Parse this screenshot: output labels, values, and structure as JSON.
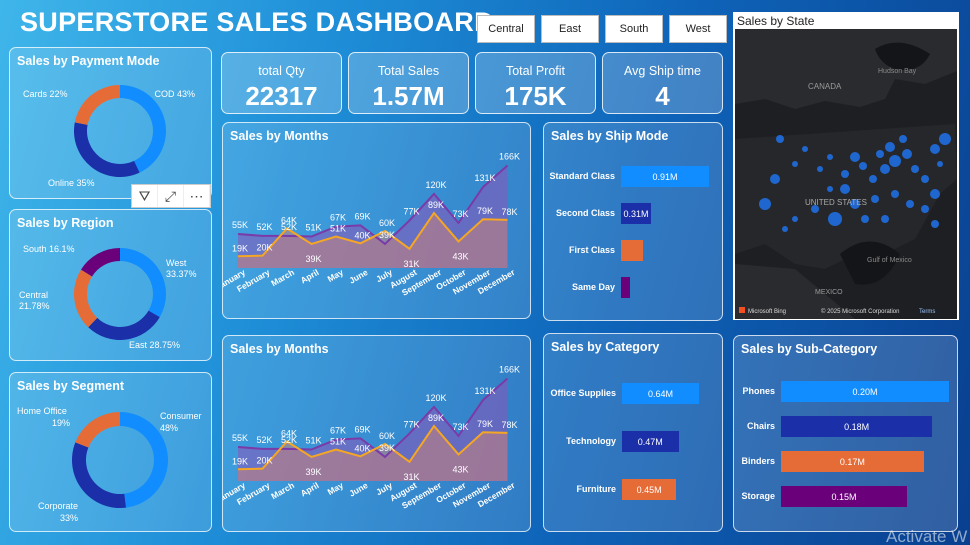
{
  "header": {
    "title": "SUPERSTORE SALES DASHBOARD"
  },
  "slicers": [
    "Central",
    "East",
    "South",
    "West"
  ],
  "kpis": [
    {
      "label": "total Qty",
      "value": "22317"
    },
    {
      "label": "Total Sales",
      "value": "1.57M"
    },
    {
      "label": "Total Profit",
      "value": "175K"
    },
    {
      "label": "Avg Ship time",
      "value": "4"
    }
  ],
  "payment": {
    "title": "Sales by Payment Mode",
    "slices": [
      {
        "label": "COD 43%",
        "value": 43,
        "color": "#118dff"
      },
      {
        "label": "Online 35%",
        "value": 35,
        "color": "#1a2fa8"
      },
      {
        "label": "Cards 22%",
        "value": 22,
        "color": "#e66c37"
      }
    ]
  },
  "region": {
    "title": "Sales by Region",
    "slices": [
      {
        "label": "West",
        "pct": "33.37%",
        "value": 33.37,
        "color": "#118dff"
      },
      {
        "label": "East 28.75%",
        "value": 28.75,
        "color": "#1a2fa8"
      },
      {
        "label": "Central",
        "pct": "21.78%",
        "value": 21.78,
        "color": "#e66c37"
      },
      {
        "label": "South 16.1%",
        "value": 16.1,
        "color": "#6b007b"
      }
    ]
  },
  "segment": {
    "title": "Sales by Segment",
    "slices": [
      {
        "label": "Consumer",
        "pct": "48%",
        "value": 48,
        "color": "#118dff"
      },
      {
        "label": "Corporate",
        "pct": "33%",
        "value": 33,
        "color": "#1a2fa8"
      },
      {
        "label": "Home Office",
        "pct": "19%",
        "value": 19,
        "color": "#e66c37"
      }
    ]
  },
  "months_chart": {
    "title": "Sales by Months"
  },
  "chart_data": [
    {
      "type": "area",
      "title": "Sales by Months",
      "categories": [
        "January",
        "February",
        "March",
        "April",
        "May",
        "June",
        "July",
        "August",
        "September",
        "October",
        "November",
        "December"
      ],
      "series": [
        {
          "values": [
            55,
            52,
            52,
            51,
            67,
            69,
            39,
            77,
            120,
            73,
            131,
            166
          ],
          "labels": [
            "55K",
            "52K",
            "52K",
            "51K",
            "67K",
            "69K",
            "39K",
            "77K",
            "120K",
            "73K",
            "131K",
            "166K"
          ],
          "color": "#7a3aa8"
        },
        {
          "values": [
            19,
            20,
            64,
            39,
            51,
            40,
            60,
            31,
            89,
            43,
            79,
            78
          ],
          "labels": [
            "19K",
            "20K",
            "64K",
            "39K",
            "51K",
            "40K",
            "60K",
            "31K",
            "89K",
            "43K",
            "79K",
            "78K"
          ],
          "color": "#f5a623"
        }
      ]
    },
    {
      "type": "area",
      "title": "Sales by Months",
      "categories": [
        "January",
        "February",
        "March",
        "April",
        "May",
        "June",
        "July",
        "August",
        "September",
        "October",
        "November",
        "December"
      ],
      "series": [
        {
          "values": [
            55,
            52,
            52,
            51,
            67,
            69,
            39,
            77,
            120,
            73,
            131,
            166
          ],
          "labels": [
            "55K",
            "52K",
            "52K",
            "51K",
            "67K",
            "69K",
            "39K",
            "77K",
            "120K",
            "73K",
            "131K",
            "166K"
          ],
          "color": "#7a3aa8"
        },
        {
          "values": [
            19,
            20,
            64,
            39,
            51,
            40,
            60,
            31,
            89,
            43,
            79,
            78
          ],
          "labels": [
            "19K",
            "20K",
            "64K",
            "39K",
            "51K",
            "40K",
            "60K",
            "31K",
            "89K",
            "43K",
            "79K",
            "78K"
          ],
          "color": "#f5a623"
        }
      ]
    },
    {
      "type": "bar",
      "title": "Sales by Ship Mode",
      "categories": [
        "Standard Class",
        "Second Class",
        "First Class",
        "Same Day"
      ],
      "values": [
        0.91,
        0.31,
        0.23,
        0.09
      ],
      "labels": [
        "0.91M",
        "0.31M",
        "",
        ""
      ]
    },
    {
      "type": "bar",
      "title": "Sales by Category",
      "categories": [
        "Office Supplies",
        "Technology",
        "Furniture"
      ],
      "values": [
        0.64,
        0.47,
        0.45
      ],
      "labels": [
        "0.64M",
        "0.47M",
        "0.45M"
      ]
    },
    {
      "type": "bar",
      "title": "Sales by Sub-Category",
      "categories": [
        "Phones",
        "Chairs",
        "Binders",
        "Storage"
      ],
      "values": [
        0.2,
        0.18,
        0.17,
        0.15
      ],
      "labels": [
        "0.20M",
        "0.18M",
        "0.17M",
        "0.15M"
      ]
    }
  ],
  "shipmode": {
    "title": "Sales by Ship Mode",
    "colors": [
      "#118dff",
      "#1a2fa8",
      "#e66c37",
      "#6b007b"
    ]
  },
  "category": {
    "title": "Sales by Category",
    "colors": [
      "#118dff",
      "#1a2fa8",
      "#e66c37"
    ]
  },
  "subcategory": {
    "title": "Sales by Sub-Category",
    "colors": [
      "#118dff",
      "#1a2fa8",
      "#e66c37",
      "#6b007b"
    ]
  },
  "map": {
    "title": "Sales by State",
    "labels": [
      "Hudson Bay",
      "CANADA",
      "UNITED STATES",
      "Gulf of Mexico",
      "MEXICO"
    ],
    "bing": "Microsoft Bing",
    "copyright": "© 2025 Microsoft Corporation",
    "terms": "Terms"
  },
  "toolbar": {
    "icons": [
      "filter-icon",
      "focus-mode-icon",
      "more-options-icon"
    ]
  },
  "watermark": "Activate W"
}
